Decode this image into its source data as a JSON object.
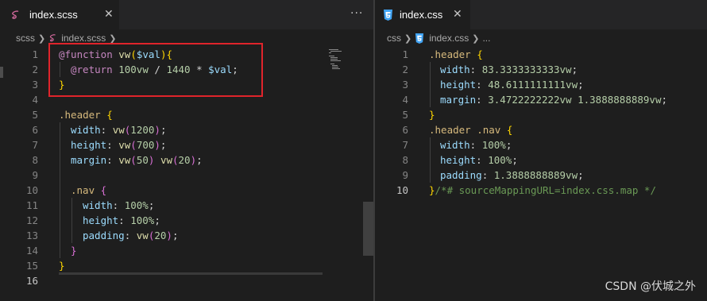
{
  "left_editor": {
    "tab": {
      "icon": "sass-icon",
      "label": "index.scss"
    },
    "more_label": "···",
    "breadcrumb": [
      "scss",
      "index.scss"
    ],
    "line_numbers": [
      "1",
      "2",
      "3",
      "4",
      "5",
      "6",
      "7",
      "8",
      "9",
      "10",
      "11",
      "12",
      "13",
      "14",
      "15",
      "16"
    ],
    "code": {
      "l1": [
        "@function",
        " vw",
        "(",
        "$val",
        ")",
        "{"
      ],
      "l2": [
        "@return",
        " ",
        "100vw",
        " / ",
        "1440",
        " * ",
        "$val",
        ";"
      ],
      "l3": [
        "}"
      ],
      "l5": [
        ".header",
        " ",
        "{"
      ],
      "l6": [
        "width",
        ": ",
        "vw",
        "(",
        "1200",
        ")",
        ";"
      ],
      "l7": [
        "height",
        ": ",
        "vw",
        "(",
        "700",
        ")",
        ";"
      ],
      "l8": [
        "margin",
        ": ",
        "vw",
        "(",
        "50",
        ")",
        " ",
        "vw",
        "(",
        "20",
        ")",
        ";"
      ],
      "l10": [
        ".nav",
        " ",
        "{"
      ],
      "l11": [
        "width",
        ": ",
        "100%",
        ";"
      ],
      "l12": [
        "height",
        ": ",
        "100%",
        ";"
      ],
      "l13": [
        "padding",
        ": ",
        "vw",
        "(",
        "20",
        ")",
        ";"
      ],
      "l14": [
        "}"
      ],
      "l15": [
        "}"
      ]
    },
    "highlight_color": "#e0242b"
  },
  "right_editor": {
    "tab": {
      "icon": "css3-icon",
      "label": "index.css"
    },
    "breadcrumb": [
      "css",
      "index.css",
      "..."
    ],
    "line_numbers": [
      "1",
      "2",
      "3",
      "4",
      "5",
      "6",
      "7",
      "8",
      "9",
      "10"
    ],
    "code": {
      "l1": [
        ".header",
        " ",
        "{"
      ],
      "l2": [
        "width",
        ": ",
        "83.3333333333vw",
        ";"
      ],
      "l3": [
        "height",
        ": ",
        "48.6111111111vw",
        ";"
      ],
      "l4": [
        "margin",
        ": ",
        "3.4722222222vw",
        " ",
        "1.3888888889vw",
        ";"
      ],
      "l5": [
        "}"
      ],
      "l6": [
        ".header .nav",
        " ",
        "{"
      ],
      "l7": [
        "width",
        ": ",
        "100%",
        ";"
      ],
      "l8": [
        "height",
        ": ",
        "100%",
        ";"
      ],
      "l9": [
        "padding",
        ": ",
        "1.3888888889vw",
        ";"
      ],
      "l10": [
        "}",
        "/*# sourceMappingURL=index.css.map */"
      ]
    }
  },
  "watermark": "CSDN @伏城之外",
  "colors": {
    "background": "#1e1e1e",
    "keyword": "#c586c0",
    "function": "#dcdcaa",
    "number": "#b5cea8",
    "property": "#9cdcfe",
    "selector": "#d7ba7d",
    "comment": "#6a9955"
  }
}
